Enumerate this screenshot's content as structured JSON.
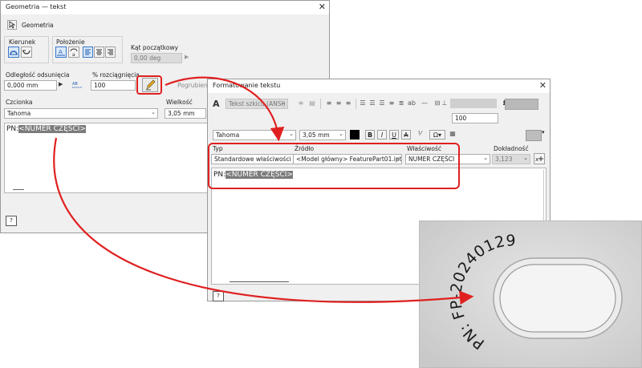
{
  "win1": {
    "title": "Geometria — tekst",
    "close": "✕",
    "geometry_label": "Geometria",
    "direction_label": "Kierunek",
    "position_label": "Położenie",
    "start_angle_label": "Kąt początkowy",
    "start_angle_value": "0,00 deg",
    "offset_label": "Odległość odsunięcia",
    "offset_value": "0,000 mm",
    "stretch_label": "% rozciągnięcia",
    "stretch_value": "100",
    "font_label": "Czcionka",
    "font_value": "Tahoma",
    "size_label": "Wielkość",
    "size_value": "3,05 mm",
    "text_prefix": "PN:",
    "text_param": "<NUMER CZĘŚCI>",
    "obscured_label": "Pogrubienie"
  },
  "win2": {
    "title": "Formatowanie tekstu",
    "close": "✕",
    "style_value": "Tekst szkicu (ANSI)",
    "stretch_value": "100",
    "font_value": "Tahoma",
    "size_value": "3,05 mm",
    "bold": "B",
    "italic": "I",
    "underline": "U",
    "strike": "A",
    "type_label": "Typ",
    "type_value": "Standardowe właściwości",
    "source_label": "Źródło",
    "source_value": "<Model główny> FeaturePart01.ipt",
    "property_label": "Właściwość",
    "property_value": "NUMER CZĘŚCI",
    "precision_label": "Dokładność",
    "precision_value": "3,123",
    "text_prefix": "PN:",
    "text_param": "<NUMER CZĘŚCI>"
  },
  "part": {
    "embossed_text": "PN: FP-20240129"
  },
  "colors": {
    "annotation_red": "#e02020",
    "selected_blue": "#3a78c8",
    "highlight_gray": "#7b7b7b"
  }
}
